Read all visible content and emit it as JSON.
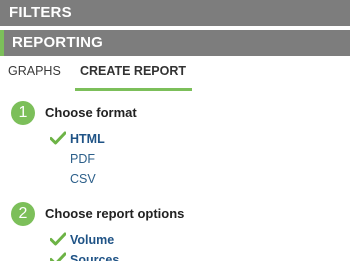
{
  "nav": {
    "filters_label": "FILTERS",
    "reporting_label": "REPORTING"
  },
  "tabs": {
    "graphs_label": "GRAPHS",
    "create_report_label": "CREATE REPORT"
  },
  "steps": [
    {
      "number": "1",
      "title": "Choose format",
      "options": [
        {
          "label": "HTML",
          "selected": true
        },
        {
          "label": "PDF",
          "selected": false
        },
        {
          "label": "CSV",
          "selected": false
        }
      ]
    },
    {
      "number": "2",
      "title": "Choose report options",
      "options": [
        {
          "label": "Volume",
          "selected": true
        },
        {
          "label": "Sources",
          "selected": true
        }
      ]
    }
  ],
  "colors": {
    "bar_gray": "#7d7d7d",
    "accent_green": "#7cbf5a",
    "link_blue": "#2c5f8a"
  },
  "icons": {
    "check": "check-icon"
  }
}
